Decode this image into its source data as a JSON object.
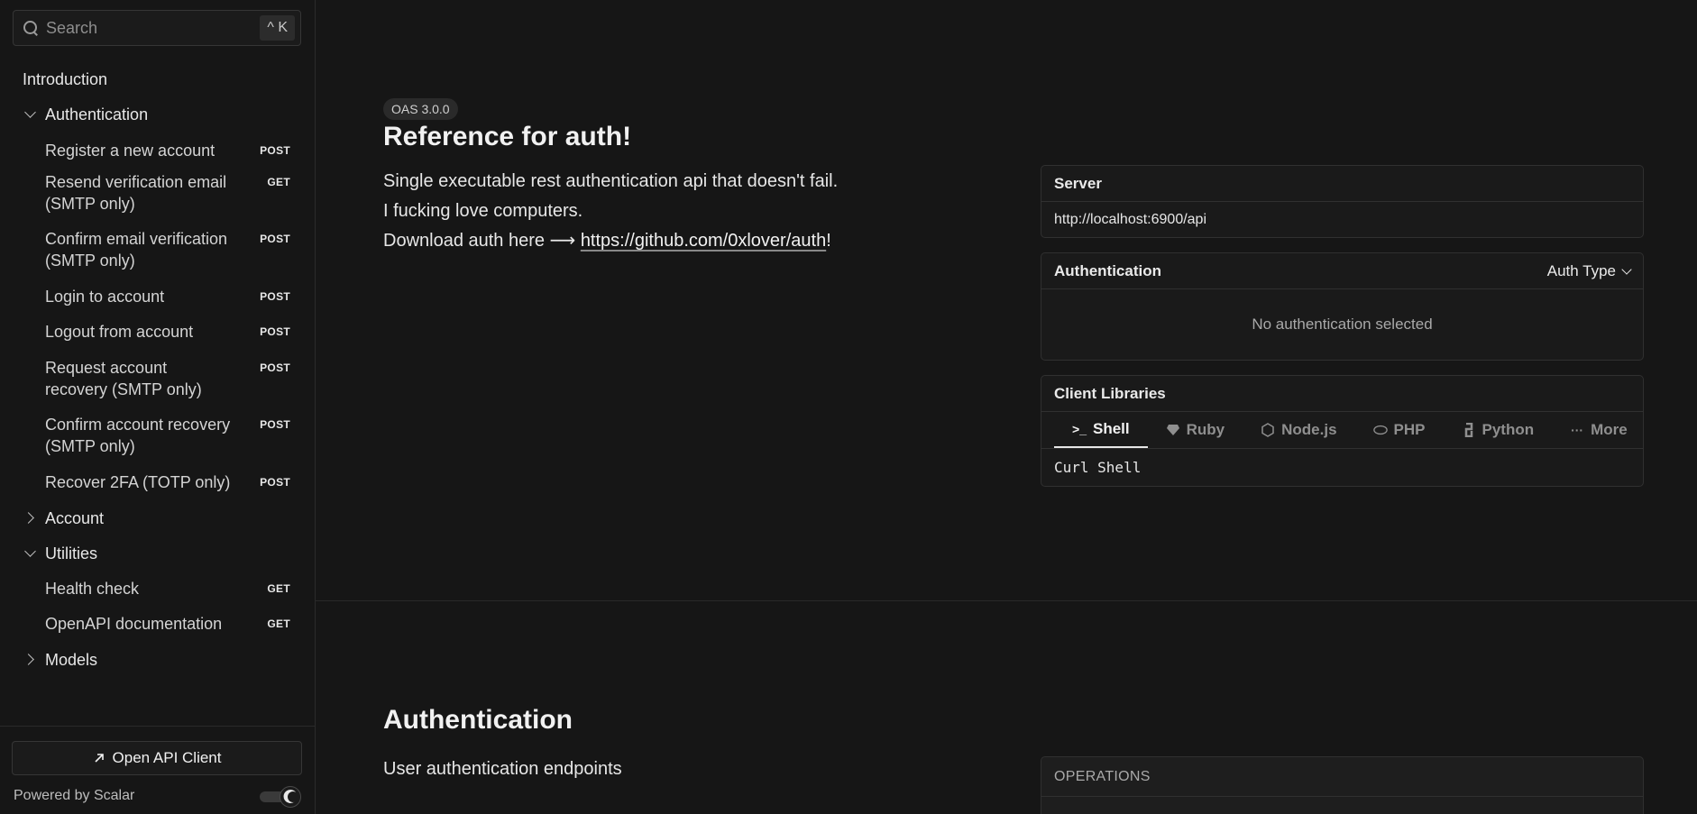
{
  "search": {
    "placeholder": "Search",
    "shortcut": "^ K"
  },
  "sidebar": {
    "intro": "Introduction",
    "groups": [
      {
        "label": "Authentication",
        "expanded": true
      },
      {
        "label": "Account",
        "expanded": false
      },
      {
        "label": "Utilities",
        "expanded": true
      },
      {
        "label": "Models",
        "expanded": false
      }
    ],
    "auth_items": [
      {
        "label": "Register a new account",
        "method": "POST"
      },
      {
        "label": "Resend verification email (SMTP only)",
        "method": "GET"
      },
      {
        "label": "Confirm email verification (SMTP only)",
        "method": "POST"
      },
      {
        "label": "Login to account",
        "method": "POST"
      },
      {
        "label": "Logout from account",
        "method": "POST"
      },
      {
        "label": "Request account recovery (SMTP only)",
        "method": "POST"
      },
      {
        "label": "Confirm account recovery (SMTP only)",
        "method": "POST"
      },
      {
        "label": "Recover 2FA (TOTP only)",
        "method": "POST"
      }
    ],
    "utility_items": [
      {
        "label": "Health check",
        "method": "GET"
      },
      {
        "label": "OpenAPI documentation",
        "method": "GET"
      }
    ],
    "open_client": "Open API Client",
    "powered_by": "Powered by Scalar"
  },
  "intro": {
    "badge": "OAS 3.0.0",
    "title": "Reference for auth!",
    "line1": "Single executable rest authentication api that doesn't fail.",
    "line2": "I fucking love computers.",
    "line3_prefix": "Download auth here ⟶ ",
    "link": "https://github.com/0xlover/auth",
    "line3_suffix": "!"
  },
  "server": {
    "title": "Server",
    "url": "http://localhost:6900/api"
  },
  "auth": {
    "title": "Authentication",
    "type_label": "Auth Type",
    "empty": "No authentication selected"
  },
  "clients": {
    "title": "Client Libraries",
    "tabs": [
      {
        "label": "Shell",
        "icon": ">_"
      },
      {
        "label": "Ruby",
        "icon": "ruby-icon"
      },
      {
        "label": "Node.js",
        "icon": "nodejs-icon"
      },
      {
        "label": "PHP",
        "icon": "php-icon"
      },
      {
        "label": "Python",
        "icon": "python-icon"
      },
      {
        "label": "More",
        "icon": "ellipsis-icon"
      }
    ],
    "selected": "Curl Shell"
  },
  "section": {
    "title": "Authentication",
    "desc": "User authentication endpoints",
    "ops_label": "OPERATIONS"
  }
}
